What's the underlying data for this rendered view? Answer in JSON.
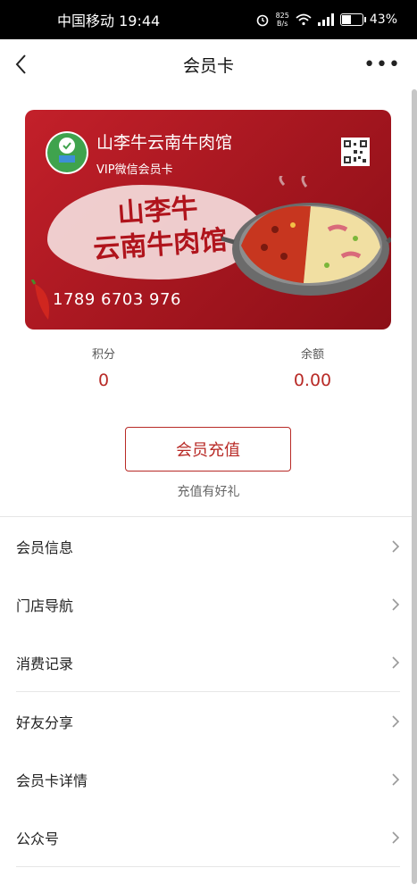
{
  "status_bar": {
    "carrier_time": "中国移动 19:44",
    "net_speed_top": "825",
    "net_speed_bottom": "B/s",
    "battery": "43%"
  },
  "nav": {
    "title": "会员卡"
  },
  "card": {
    "shop_name": "山李牛云南牛肉馆",
    "card_type": "VIP微信会员卡",
    "brand_line1": "山李牛",
    "brand_line2": "云南牛肉馆",
    "card_number": "1789 6703 976",
    "colors": {
      "primary": "#b51d26",
      "accent": "#b82a26"
    }
  },
  "stats": {
    "points_label": "积分",
    "points_value": "0",
    "balance_label": "余额",
    "balance_value": "0.00"
  },
  "recharge": {
    "button_label": "会员充值",
    "hint": "充值有好礼"
  },
  "menu": [
    {
      "label": "会员信息"
    },
    {
      "label": "门店导航"
    },
    {
      "label": "消费记录"
    },
    {
      "label": "好友分享"
    },
    {
      "label": "会员卡详情"
    },
    {
      "label": "公众号"
    }
  ]
}
